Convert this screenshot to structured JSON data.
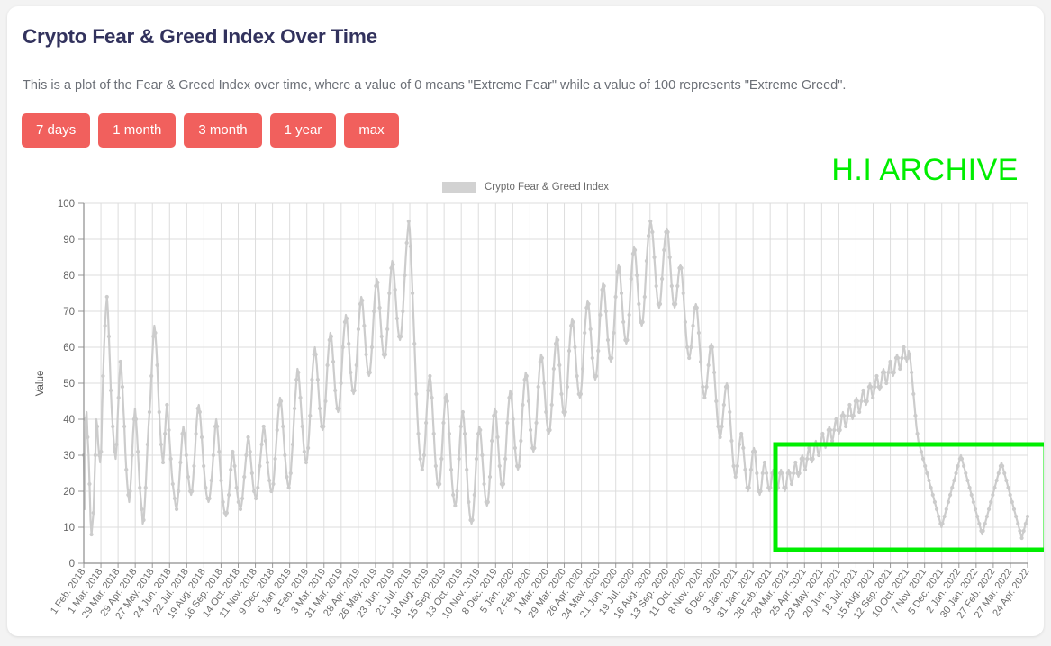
{
  "page": {
    "title": "Crypto Fear & Greed Index Over Time",
    "description": "This is a plot of the Fear & Greed Index over time, where a value of 0 means \"Extreme Fear\" while a value of 100 represents \"Extreme Greed\".",
    "watermark": "H.I ARCHIVE",
    "background_color": "#f3f3f3",
    "card_color": "#ffffff"
  },
  "range_buttons": [
    {
      "label": "7 days",
      "name": "range-7-days"
    },
    {
      "label": "1 month",
      "name": "range-1-month"
    },
    {
      "label": "3 month",
      "name": "range-3-month"
    },
    {
      "label": "1 year",
      "name": "range-1-year"
    },
    {
      "label": "max",
      "name": "range-max"
    }
  ],
  "colors": {
    "button": "#f1605d",
    "series": "#cccccc",
    "highlight": "#00ee00",
    "grid": "#dddddd",
    "title": "#32325d"
  },
  "chart_data": {
    "type": "line",
    "title": "",
    "xlabel": "",
    "ylabel": "Value",
    "ylim": [
      0,
      100
    ],
    "yticks": [
      0,
      10,
      20,
      30,
      40,
      50,
      60,
      70,
      80,
      90,
      100
    ],
    "grid": true,
    "legend_position": "top-center",
    "series": [
      {
        "name": "Crypto Fear & Greed Index",
        "color": "#cccccc",
        "marker": "circle"
      }
    ],
    "xticks": [
      "1 Feb. 2018",
      "1 Mar. 2018",
      "29 Mar. 2018",
      "29 Apr. 2018",
      "27 May. 2018",
      "24 Jun. 2018",
      "22 Jul. 2018",
      "19 Aug. 2018",
      "16 Sep. 2018",
      "14 Oct. 2018",
      "11 Nov. 2018",
      "9 Dec. 2018",
      "6 Jan. 2019",
      "3 Feb. 2019",
      "3 Mar. 2019",
      "31 Mar. 2019",
      "28 Apr. 2019",
      "26 May. 2019",
      "23 Jun. 2019",
      "21 Jul. 2019",
      "18 Aug. 2019",
      "15 Sep. 2019",
      "13 Oct. 2019",
      "10 Nov. 2019",
      "8 Dec. 2019",
      "5 Jan. 2020",
      "2 Feb. 2020",
      "1 Mar. 2020",
      "29 Mar. 2020",
      "26 Apr. 2020",
      "24 May. 2020",
      "21 Jun. 2020",
      "19 Jul. 2020",
      "16 Aug. 2020",
      "13 Sep. 2020",
      "11 Oct. 2020",
      "8 Nov. 2020",
      "6 Dec. 2020",
      "3 Jan. 2021",
      "31 Jan. 2021",
      "28 Feb. 2021",
      "28 Mar. 2021",
      "25 Apr. 2021",
      "23 May. 2021",
      "20 Jun. 2021",
      "18 Jul. 2021",
      "15 Aug. 2021",
      "12 Sep. 2021",
      "10 Oct. 2021",
      "7 Nov. 2021",
      "5 Dec. 2021",
      "2 Jan. 2022",
      "30 Jan. 2022",
      "27 Feb. 2022",
      "27 Mar. 2022",
      "24 Apr. 2022"
    ],
    "values": [
      30,
      15,
      40,
      42,
      35,
      30,
      22,
      12,
      8,
      11,
      14,
      22,
      30,
      40,
      38,
      33,
      30,
      28,
      31,
      43,
      52,
      60,
      66,
      71,
      74,
      70,
      63,
      56,
      48,
      42,
      38,
      34,
      31,
      29,
      33,
      40,
      46,
      52,
      56,
      54,
      49,
      43,
      38,
      31,
      26,
      22,
      19,
      17,
      20,
      24,
      30,
      36,
      40,
      43,
      40,
      36,
      31,
      26,
      21,
      18,
      15,
      11,
      12,
      16,
      21,
      27,
      33,
      38,
      42,
      46,
      52,
      58,
      63,
      66,
      64,
      60,
      55,
      48,
      42,
      37,
      33,
      30,
      28,
      31,
      36,
      41,
      44,
      41,
      37,
      33,
      29,
      25,
      22,
      20,
      18,
      16,
      15,
      17,
      20,
      24,
      28,
      32,
      36,
      38,
      36,
      33,
      30,
      27,
      24,
      22,
      20,
      19,
      20,
      23,
      27,
      31,
      36,
      40,
      43,
      44,
      42,
      39,
      35,
      31,
      27,
      24,
      21,
      19,
      18,
      17,
      18,
      20,
      23,
      26,
      30,
      34,
      38,
      40,
      38,
      35,
      31,
      27,
      23,
      20,
      17,
      15,
      14,
      13,
      14,
      16,
      19,
      22,
      26,
      29,
      31,
      30,
      27,
      24,
      21,
      19,
      17,
      16,
      15,
      16,
      18,
      21,
      24,
      27,
      30,
      33,
      35,
      34,
      31,
      28,
      25,
      22,
      20,
      19,
      18,
      19,
      21,
      24,
      27,
      30,
      33,
      36,
      38,
      37,
      34,
      31,
      28,
      25,
      23,
      21,
      20,
      20,
      22,
      25,
      29,
      33,
      37,
      41,
      44,
      46,
      45,
      42,
      38,
      34,
      30,
      27,
      24,
      22,
      21,
      22,
      25,
      29,
      33,
      38,
      43,
      47,
      51,
      54,
      53,
      50,
      46,
      42,
      38,
      34,
      31,
      29,
      28,
      29,
      32,
      36,
      41,
      46,
      51,
      55,
      58,
      60,
      58,
      55,
      51,
      47,
      43,
      40,
      38,
      37,
      38,
      41,
      45,
      50,
      55,
      59,
      62,
      64,
      63,
      60,
      56,
      52,
      48,
      45,
      43,
      42,
      43,
      46,
      50,
      55,
      60,
      64,
      67,
      69,
      68,
      65,
      61,
      57,
      53,
      50,
      48,
      47,
      48,
      51,
      55,
      60,
      65,
      69,
      72,
      74,
      73,
      70,
      66,
      62,
      58,
      55,
      53,
      52,
      53,
      56,
      60,
      65,
      70,
      74,
      77,
      79,
      78,
      75,
      71,
      67,
      63,
      60,
      58,
      57,
      58,
      61,
      65,
      70,
      75,
      79,
      82,
      84,
      83,
      80,
      76,
      72,
      68,
      65,
      63,
      62,
      63,
      66,
      70,
      75,
      80,
      85,
      89,
      92,
      95,
      93,
      88,
      82,
      75,
      68,
      61,
      54,
      47,
      41,
      36,
      32,
      29,
      27,
      26,
      27,
      30,
      34,
      39,
      44,
      48,
      51,
      52,
      50,
      46,
      41,
      36,
      31,
      27,
      24,
      22,
      21,
      22,
      25,
      29,
      34,
      39,
      43,
      46,
      47,
      45,
      41,
      36,
      31,
      26,
      22,
      19,
      17,
      16,
      17,
      20,
      24,
      29,
      34,
      38,
      41,
      42,
      40,
      36,
      31,
      26,
      21,
      17,
      14,
      12,
      11,
      12,
      15,
      19,
      24,
      29,
      33,
      36,
      38,
      37,
      34,
      30,
      26,
      22,
      19,
      17,
      16,
      17,
      20,
      24,
      29,
      34,
      38,
      41,
      43,
      42,
      39,
      35,
      31,
      27,
      24,
      22,
      21,
      22,
      25,
      29,
      34,
      39,
      43,
      46,
      48,
      47,
      44,
      40,
      36,
      32,
      29,
      27,
      26,
      27,
      30,
      34,
      39,
      44,
      48,
      51,
      53,
      52,
      49,
      45,
      41,
      37,
      34,
      32,
      31,
      32,
      35,
      39,
      44,
      49,
      53,
      56,
      58,
      57,
      54,
      50,
      46,
      42,
      39,
      37,
      36,
      37,
      40,
      44,
      49,
      54,
      58,
      61,
      63,
      62,
      59,
      55,
      51,
      47,
      44,
      42,
      41,
      42,
      45,
      49,
      54,
      59,
      63,
      66,
      68,
      67,
      64,
      60,
      56,
      52,
      49,
      47,
      46,
      47,
      50,
      54,
      59,
      64,
      68,
      71,
      73,
      72,
      69,
      65,
      61,
      57,
      54,
      52,
      51,
      52,
      55,
      59,
      64,
      69,
      73,
      76,
      78,
      77,
      74,
      70,
      66,
      62,
      59,
      57,
      56,
      57,
      60,
      64,
      69,
      74,
      78,
      81,
      83,
      82,
      79,
      75,
      71,
      67,
      64,
      62,
      61,
      62,
      65,
      69,
      74,
      79,
      83,
      86,
      88,
      87,
      84,
      80,
      76,
      72,
      69,
      67,
      66,
      67,
      70,
      74,
      79,
      84,
      88,
      91,
      93,
      95,
      94,
      92,
      89,
      85,
      81,
      77,
      74,
      72,
      71,
      72,
      75,
      79,
      83,
      87,
      90,
      92,
      93,
      92,
      89,
      85,
      81,
      77,
      74,
      72,
      71,
      72,
      74,
      77,
      80,
      82,
      83,
      82,
      79,
      75,
      71,
      67,
      63,
      60,
      58,
      57,
      58,
      60,
      63,
      66,
      69,
      71,
      72,
      71,
      68,
      64,
      60,
      56,
      52,
      49,
      47,
      46,
      47,
      49,
      52,
      55,
      58,
      60,
      61,
      60,
      57,
      53,
      49,
      45,
      41,
      38,
      36,
      35,
      36,
      38,
      41,
      44,
      47,
      49,
      50,
      49,
      46,
      42,
      38,
      34,
      30,
      27,
      25,
      24,
      25,
      27,
      30,
      33,
      35,
      36,
      35,
      32,
      29,
      26,
      23,
      21,
      20,
      21,
      23,
      26,
      29,
      31,
      32,
      31,
      28,
      25,
      22,
      20,
      19,
      20,
      22,
      25,
      27,
      28,
      27,
      25,
      23,
      21,
      20,
      21,
      23,
      25,
      26,
      25,
      23,
      21,
      20,
      21,
      23,
      25,
      26,
      25,
      23,
      21,
      20,
      21,
      23,
      25,
      26,
      25,
      23,
      22,
      23,
      25,
      27,
      28,
      27,
      25,
      24,
      25,
      27,
      29,
      30,
      29,
      27,
      26,
      27,
      29,
      31,
      32,
      31,
      29,
      28,
      29,
      31,
      33,
      34,
      33,
      31,
      30,
      31,
      33,
      35,
      36,
      35,
      33,
      32,
      33,
      35,
      37,
      38,
      37,
      35,
      34,
      35,
      37,
      39,
      40,
      39,
      37,
      36,
      37,
      39,
      41,
      42,
      41,
      39,
      38,
      39,
      41,
      43,
      44,
      43,
      41,
      40,
      41,
      43,
      45,
      46,
      45,
      43,
      42,
      43,
      45,
      47,
      48,
      47,
      45,
      44,
      45,
      47,
      49,
      50,
      49,
      47,
      46,
      47,
      49,
      51,
      52,
      51,
      49,
      48,
      49,
      51,
      53,
      54,
      53,
      51,
      50,
      51,
      53,
      55,
      56,
      55,
      53,
      52,
      53,
      55,
      57,
      58,
      57,
      55,
      54,
      55,
      57,
      59,
      60,
      59,
      57,
      56,
      57,
      59,
      58,
      56,
      53,
      50,
      47,
      44,
      41,
      38,
      36,
      34,
      33,
      32,
      31,
      30,
      29,
      28,
      27,
      26,
      25,
      24,
      23,
      22,
      21,
      20,
      19,
      18,
      17,
      16,
      15,
      14,
      13,
      12,
      11,
      10,
      11,
      12,
      13,
      14,
      15,
      16,
      17,
      18,
      19,
      20,
      21,
      22,
      23,
      24,
      25,
      26,
      27,
      28,
      29,
      30,
      29,
      28,
      27,
      26,
      25,
      24,
      23,
      22,
      21,
      20,
      19,
      18,
      17,
      16,
      15,
      14,
      13,
      12,
      11,
      10,
      9,
      8,
      9,
      10,
      11,
      12,
      13,
      14,
      15,
      16,
      17,
      18,
      19,
      20,
      21,
      22,
      23,
      24,
      25,
      26,
      27,
      28,
      27,
      26,
      25,
      24,
      23,
      22,
      21,
      20,
      19,
      18,
      17,
      16,
      15,
      14,
      13,
      12,
      11,
      10,
      9,
      8,
      7,
      8,
      9,
      10,
      11,
      12,
      13
    ],
    "annotation": {
      "type": "rectangle",
      "color": "#00ee00",
      "note": "highlight box over late-2021 to 2022 region"
    }
  },
  "axes": {
    "y_title": "Value",
    "legend_label": "Crypto Fear & Greed Index"
  }
}
